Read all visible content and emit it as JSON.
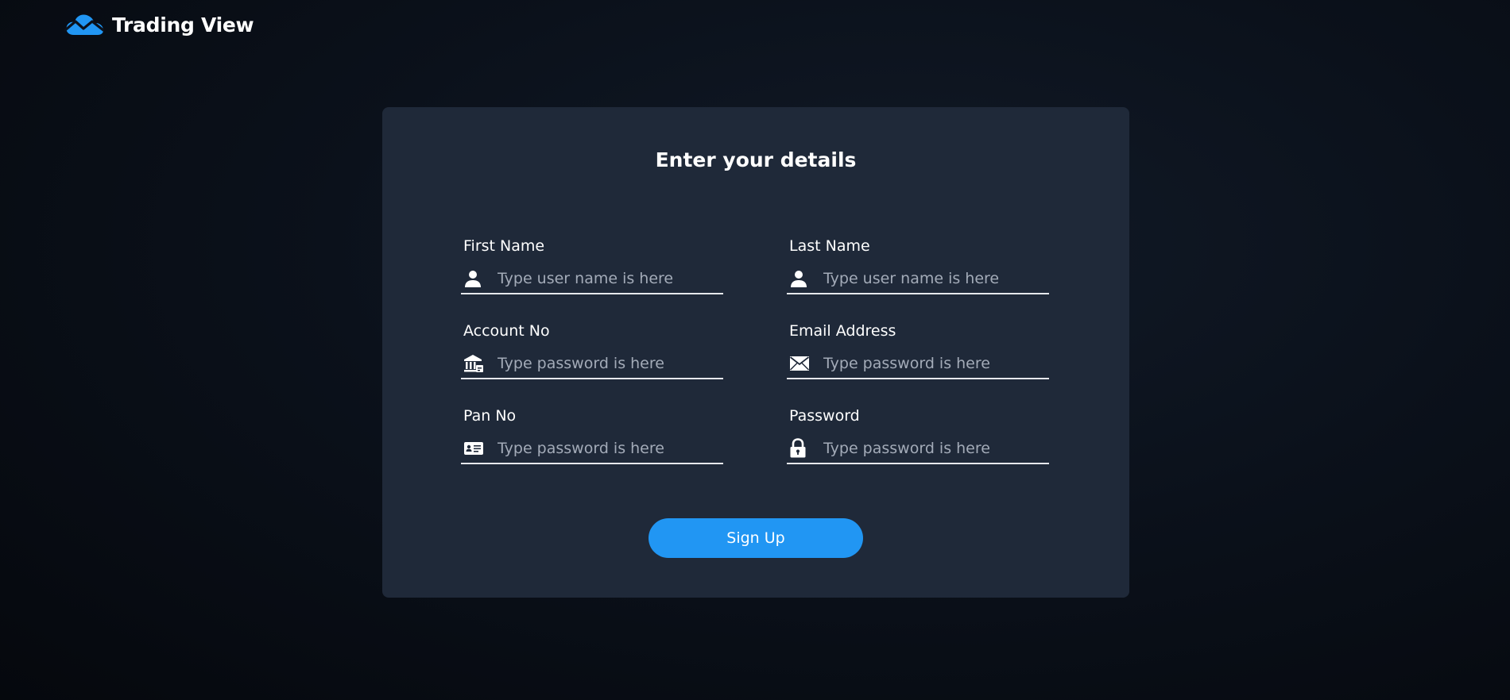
{
  "brand": {
    "name": "Trading View",
    "icon": "cloud-chart-logo"
  },
  "form": {
    "title": "Enter your details",
    "fields": [
      {
        "label": "First Name",
        "placeholder": "Type user name is here",
        "icon": "user-icon"
      },
      {
        "label": "Last Name",
        "placeholder": "Type user name is here",
        "icon": "user-icon"
      },
      {
        "label": "Account No",
        "placeholder": "Type password is here",
        "icon": "bank-icon"
      },
      {
        "label": "Email Address",
        "placeholder": "Type password is here",
        "icon": "envelope-icon"
      },
      {
        "label": "Pan No",
        "placeholder": "Type password is here",
        "icon": "id-card-icon"
      },
      {
        "label": "Password",
        "placeholder": "Type password is here",
        "icon": "lock-icon"
      }
    ],
    "submit_label": "Sign Up"
  },
  "colors": {
    "accent": "#2196f3",
    "card_background": "#1f2939",
    "page_background": "#0b111b",
    "placeholder": "#a3abb8"
  }
}
